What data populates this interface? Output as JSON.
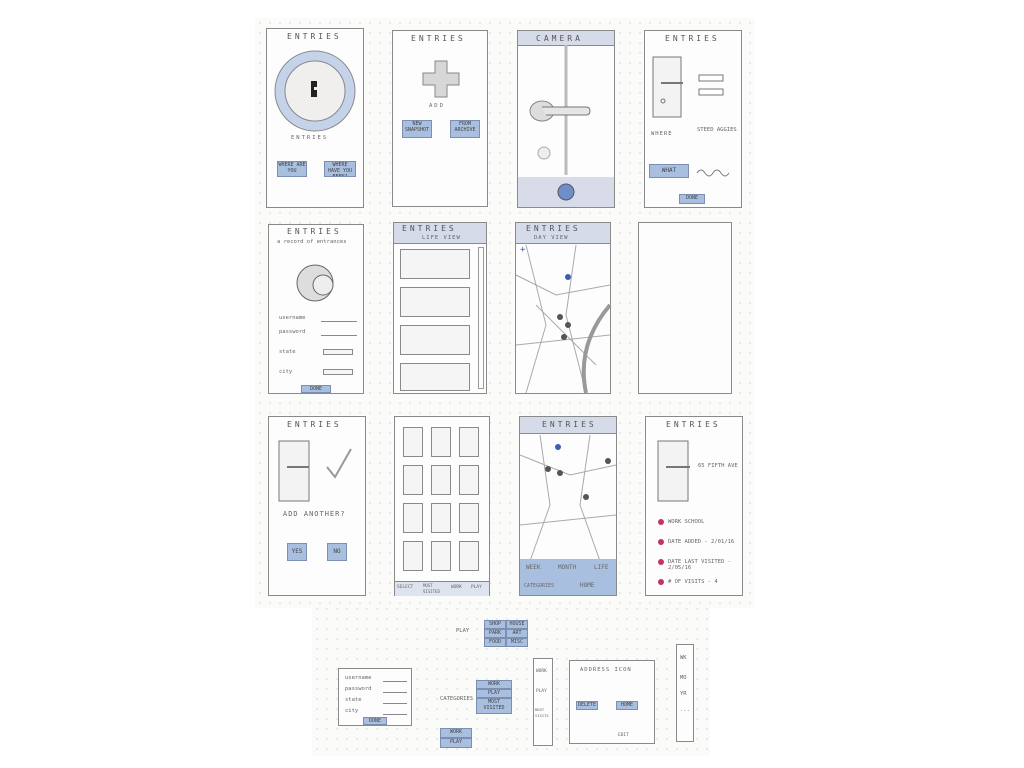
{
  "screens": {
    "s1": {
      "title": "ENTRIES",
      "label": "ENTRIES",
      "btn_left": "WHERE ARE YOU",
      "btn_right": "WHERE HAVE YOU BEEN?"
    },
    "s2": {
      "title": "ENTRIES",
      "add": "ADD",
      "btn_left": "NEW SNAPSHOT",
      "btn_right": "FROM ARCHIVE"
    },
    "s3": {
      "title": "CAMERA"
    },
    "s4": {
      "title": "ENTRIES",
      "where": "WHERE",
      "where_value": "STEED AGGIES",
      "what": "WHAT",
      "done": "DONE"
    },
    "s5": {
      "title": "ENTRIES",
      "subtitle": "a record of entrances",
      "username": "username",
      "password": "password",
      "state": "state",
      "city": "city",
      "done": "DONE"
    },
    "s6": {
      "title": "ENTRIES",
      "subtitle": "LIFE VIEW"
    },
    "s7": {
      "title": "ENTRIES",
      "subtitle": "DAY VIEW"
    },
    "s9": {
      "title": "ENTRIES",
      "add_another": "ADD ANOTHER?",
      "yes": "YES",
      "no": "NO"
    },
    "s10": {
      "tabs": [
        "SELECT",
        "MOST VISITED",
        "WORK",
        "PLAY"
      ]
    },
    "s11": {
      "title": "ENTRIES",
      "tabs": [
        "WEEK",
        "MONTH",
        "LIFE",
        "CATEGORIES",
        "HOME"
      ]
    },
    "s12": {
      "title": "ENTRIES",
      "address": "65 FIFTH AVE",
      "bullets": [
        "WORK   SCHOOL",
        "DATE ADDED - 2/01/16",
        "DATE LAST VISITED - 2/05/16",
        "# OF VISITS - 4"
      ]
    }
  },
  "bottom": {
    "menu_left": "PLAY",
    "menu_grid": [
      "SHOP",
      "HOUSE",
      "PARK",
      "ART",
      "FOOD",
      "MISC"
    ],
    "login": {
      "username": "username",
      "password": "password",
      "state": "state",
      "city": "city",
      "done": "DONE"
    },
    "categories_label": "CATEGORIES",
    "categories": [
      "WORK",
      "PLAY",
      "MOST VISITED"
    ],
    "work_play": [
      "WORK",
      "PLAY"
    ],
    "side_tabs": [
      "WORK",
      "PLAY",
      "MOST VISITS"
    ],
    "address_label": "ADDRESS ICON",
    "delete": "DELETE",
    "home": "HOME",
    "edit": "EDIT",
    "range": [
      "WK",
      "MO",
      "YR",
      "..."
    ]
  },
  "colors": {
    "accent": "#a9bfe0",
    "header": "#d6dbe9",
    "pin_dark": "#555555",
    "pin_blue": "#3a5fb0",
    "dot": "#c2336a"
  }
}
